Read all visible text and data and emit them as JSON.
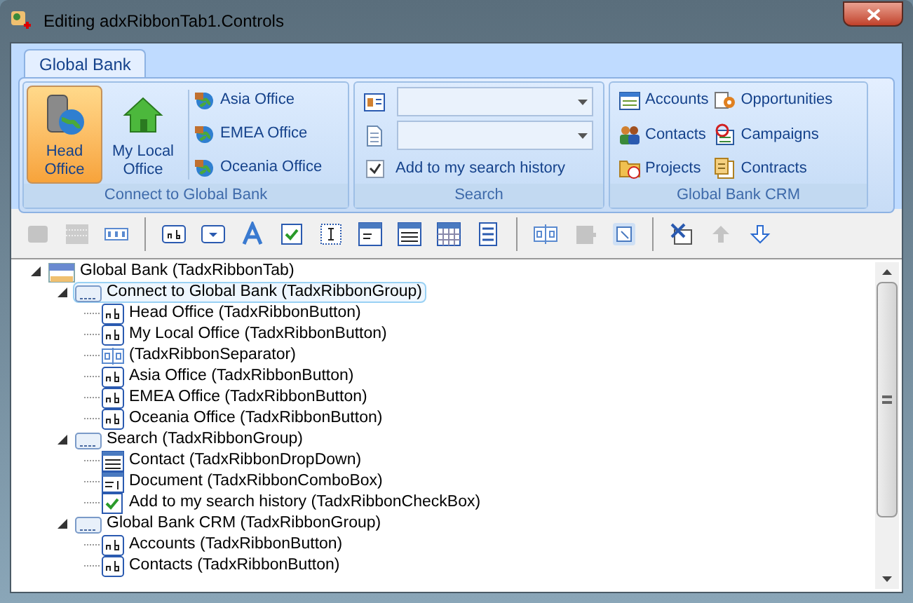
{
  "window": {
    "title": "Editing adxRibbonTab1.Controls"
  },
  "ribbon": {
    "tabs": [
      {
        "label": "Global Bank",
        "selected": true
      }
    ],
    "groups": [
      {
        "label": "Connect to Global Bank",
        "kind": "connect",
        "large_buttons": [
          {
            "label": "Head Office",
            "selected": true
          },
          {
            "label": "My Local Office",
            "selected": false
          }
        ],
        "small_buttons": [
          "Asia Office",
          "EMEA Office",
          "Oceania Office"
        ]
      },
      {
        "label": "Search",
        "kind": "search",
        "checkbox": {
          "label": "Add to my search history",
          "checked": true
        }
      },
      {
        "label": "Global Bank CRM",
        "kind": "crm",
        "buttons": [
          "Accounts",
          "Opportunities",
          "Contacts",
          "Campaigns",
          "Projects",
          "Contracts"
        ]
      }
    ]
  },
  "toolbar": [
    {
      "kind": "button",
      "disabled": true
    },
    {
      "kind": "button",
      "disabled": true
    },
    {
      "kind": "button",
      "disabled": false
    },
    {
      "kind": "separator"
    },
    {
      "kind": "button",
      "disabled": false
    },
    {
      "kind": "button",
      "disabled": false
    },
    {
      "kind": "button",
      "disabled": false
    },
    {
      "kind": "button",
      "disabled": false
    },
    {
      "kind": "button",
      "disabled": false
    },
    {
      "kind": "button",
      "disabled": false
    },
    {
      "kind": "button",
      "disabled": false
    },
    {
      "kind": "button",
      "disabled": false
    },
    {
      "kind": "button",
      "disabled": false
    },
    {
      "kind": "separator"
    },
    {
      "kind": "button",
      "disabled": false
    },
    {
      "kind": "button",
      "disabled": true
    },
    {
      "kind": "button",
      "disabled": false
    },
    {
      "kind": "separator"
    },
    {
      "kind": "button",
      "disabled": false
    },
    {
      "kind": "button",
      "disabled": true
    },
    {
      "kind": "button",
      "disabled": false
    }
  ],
  "tree": [
    {
      "label": "Global Bank (TadxRibbonTab)",
      "kind": "tab",
      "expanded": true,
      "selected": false,
      "children": [
        {
          "label": "Connect to Global Bank (TadxRibbonGroup)",
          "kind": "group",
          "expanded": true,
          "selected": true,
          "children": [
            {
              "label": "Head Office (TadxRibbonButton)",
              "kind": "button",
              "selected": false
            },
            {
              "label": "My Local Office (TadxRibbonButton)",
              "kind": "button",
              "selected": false
            },
            {
              "label": "(TadxRibbonSeparator)",
              "kind": "separator",
              "selected": false
            },
            {
              "label": "Asia Office (TadxRibbonButton)",
              "kind": "button",
              "selected": false
            },
            {
              "label": "EMEA Office (TadxRibbonButton)",
              "kind": "button",
              "selected": false
            },
            {
              "label": "Oceania Office (TadxRibbonButton)",
              "kind": "button",
              "selected": false
            }
          ]
        },
        {
          "label": "Search (TadxRibbonGroup)",
          "kind": "group",
          "expanded": true,
          "selected": false,
          "children": [
            {
              "label": "Contact (TadxRibbonDropDown)",
              "kind": "dropdown",
              "selected": false
            },
            {
              "label": "Document (TadxRibbonComboBox)",
              "kind": "combobox",
              "selected": false
            },
            {
              "label": "Add to my search history (TadxRibbonCheckBox)",
              "kind": "checkbox",
              "selected": false
            }
          ]
        },
        {
          "label": "Global Bank CRM (TadxRibbonGroup)",
          "kind": "group",
          "expanded": true,
          "selected": false,
          "children": [
            {
              "label": "Accounts (TadxRibbonButton)",
              "kind": "button",
              "selected": false
            },
            {
              "label": "Contacts (TadxRibbonButton)",
              "kind": "button",
              "selected": false
            }
          ]
        }
      ]
    }
  ]
}
